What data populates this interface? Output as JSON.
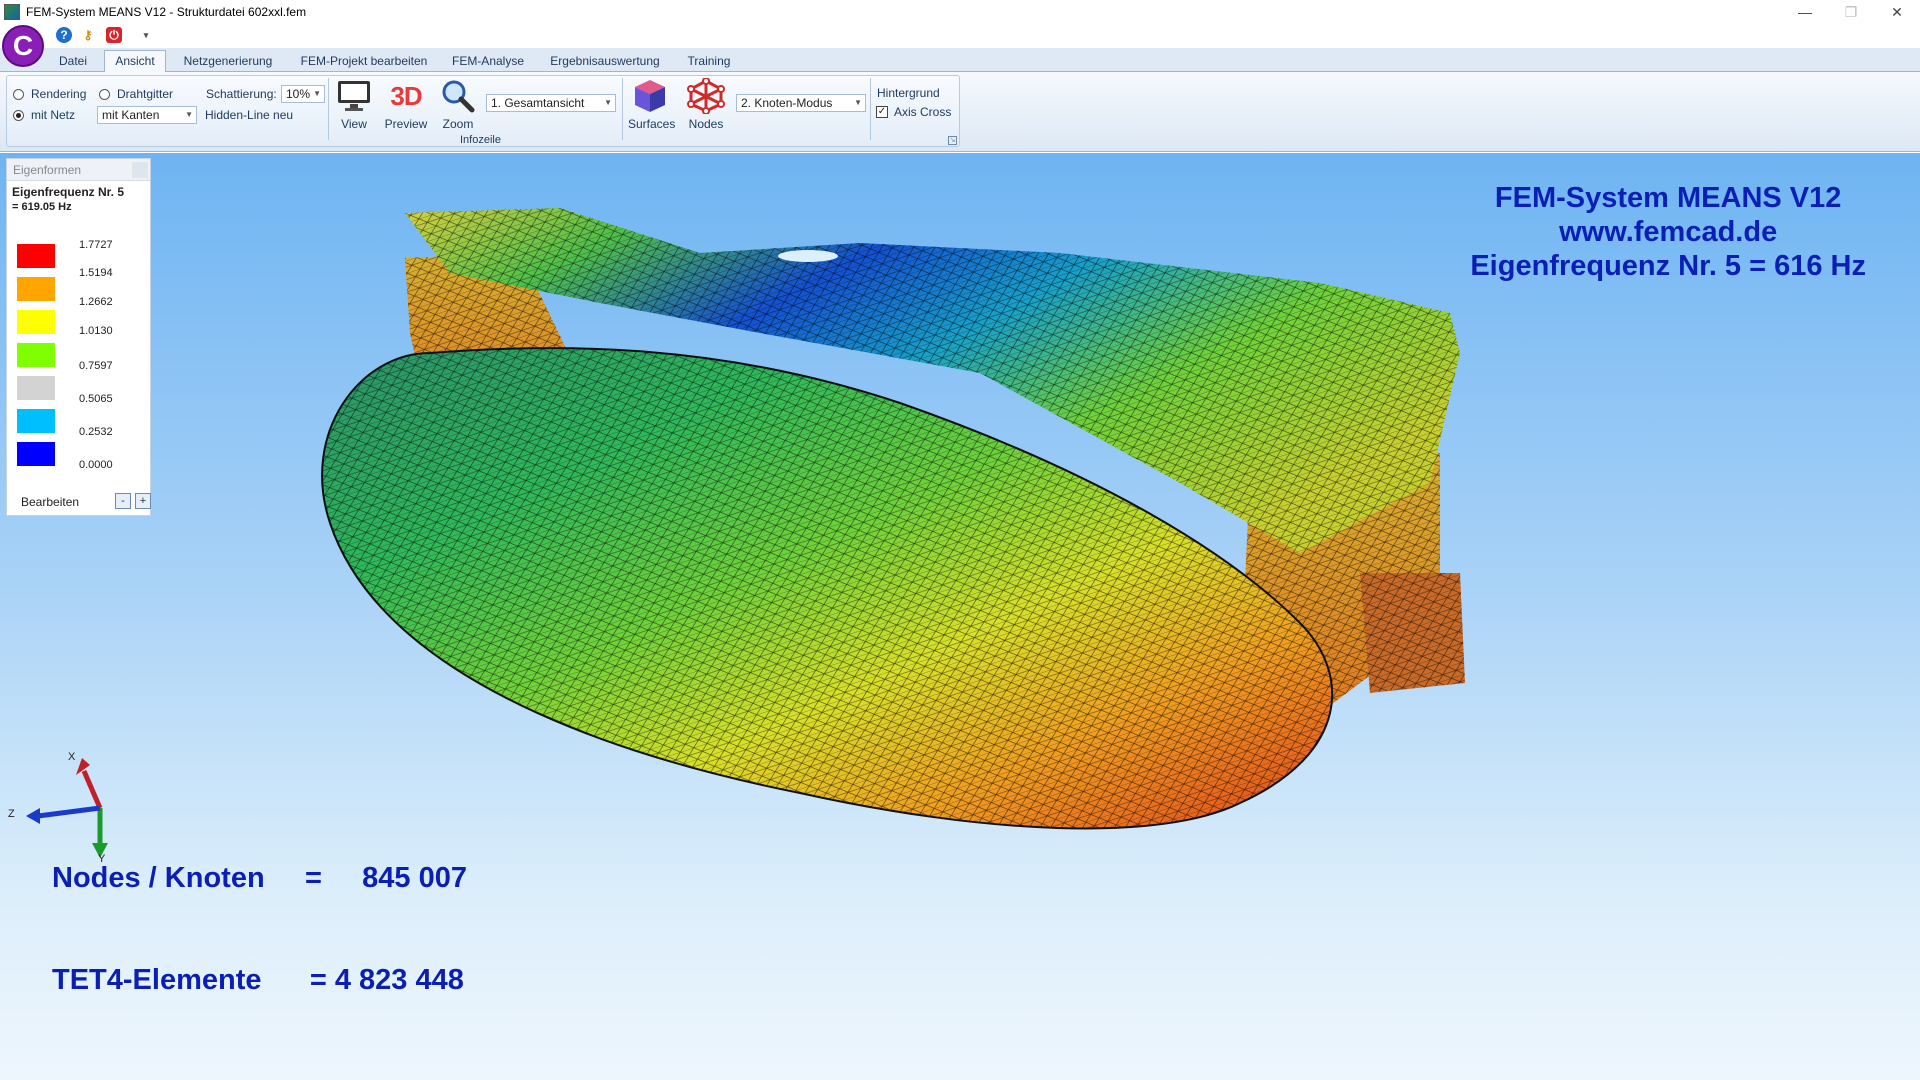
{
  "window": {
    "title": "FEM-System MEANS V12 - Strukturdatei  602xxl.fem",
    "minimize": "—",
    "restore": "❐",
    "close": "✕"
  },
  "quick_access": {
    "logo_glyph": "C",
    "help_glyph": "?",
    "key_glyph": "⚷",
    "power_glyph": "⏻",
    "dropdown_glyph": "▾"
  },
  "tabs": [
    {
      "label": "Datei"
    },
    {
      "label": "Ansicht",
      "active": true
    },
    {
      "label": "Netzgenerierung"
    },
    {
      "label": "FEM-Projekt bearbeiten"
    },
    {
      "label": "FEM-Analyse"
    },
    {
      "label": "Ergebnisauswertung"
    },
    {
      "label": "Training"
    }
  ],
  "ribbon": {
    "rendering_label": "Rendering",
    "drahtgitter_label": "Drahtgitter",
    "mitnetz_label": "mit Netz",
    "selected_mode": "mit Netz",
    "kanten_combo": "mit Kanten",
    "schattierung_label": "Schattierung:",
    "schattierung_value": "10%",
    "hiddenline_label": "Hidden-Line neu",
    "view_label": "View",
    "preview_label": "Preview",
    "preview_glyph": "3D",
    "zoom_label": "Zoom",
    "ansicht_combo": "1.   Gesamtansicht",
    "surfaces_label": "Surfaces",
    "nodes_label": "Nodes",
    "modus_combo": "2.   Knoten-Modus",
    "hintergrund_label": "Hintergrund",
    "axiscross_label": "Axis Cross",
    "axiscross_checked": true,
    "group_label": "Infozeile"
  },
  "legend": {
    "header": "Eigenformen",
    "freq_title": "Eigenfrequenz Nr. 5",
    "freq_value": "=  619.05 Hz",
    "items": [
      {
        "color": "#ff0000",
        "value": "1.7727"
      },
      {
        "color": "#ffa500",
        "value": "1.5194"
      },
      {
        "color": "#ffff00",
        "value": "1.2662"
      },
      {
        "color": "#80ff00",
        "value": "1.0130"
      },
      {
        "color": "#d3d3d3",
        "value": "0.7597"
      },
      {
        "color": "#00bfff",
        "value": "0.5065"
      },
      {
        "color": "#0000ff",
        "value": "0.2532"
      },
      {
        "color": "#ffffff",
        "value": "0.0000"
      }
    ],
    "edit_label": "Bearbeiten",
    "minus": "-",
    "plus": "+"
  },
  "annotations": {
    "line1": "FEM-System MEANS V12",
    "line2": "www.femcad.de",
    "line3": "Eigenfrequenz Nr. 5 = 616 Hz",
    "nodes_line": "Nodes / Knoten     =     845 007",
    "elements_line": "TET4-Elemente      = 4 823 448"
  },
  "axis": {
    "x": "X",
    "y": "Y",
    "z": "Z"
  }
}
